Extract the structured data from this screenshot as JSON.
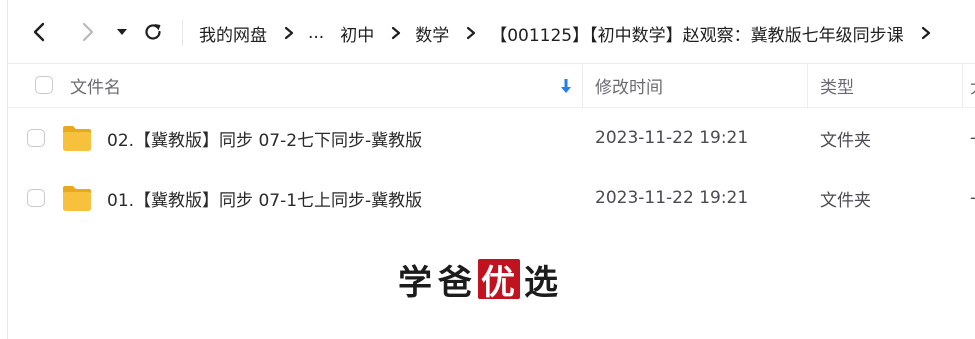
{
  "navigation": {
    "back_icon": "chevron-left-icon",
    "forward_icon": "chevron-right-icon",
    "dropdown_icon": "caret-down-icon",
    "refresh_icon": "refresh-icon"
  },
  "breadcrumb": {
    "items": [
      "我的网盘",
      "...",
      "初中",
      "数学",
      "【001125】【初中数学】赵观察：冀教版七年级同步课"
    ],
    "separator_icon": "chevron-right-icon"
  },
  "table": {
    "headers": {
      "name": "文件名",
      "modified": "修改时间",
      "type": "类型",
      "size": "大"
    },
    "sort_icon": "sort-down-arrow-icon",
    "rows": [
      {
        "name": "02.【冀教版】同步 07-2七下同步-冀教版",
        "modified": "2023-11-22 19:21",
        "type": "文件夹",
        "size": "-",
        "icon": "folder-icon"
      },
      {
        "name": "01.【冀教版】同步 07-1七上同步-冀教版",
        "modified": "2023-11-22 19:21",
        "type": "文件夹",
        "size": "-",
        "icon": "folder-icon"
      }
    ]
  },
  "watermark": {
    "chars": [
      "学",
      "爸",
      "优",
      "选"
    ]
  },
  "colors": {
    "accent": "#1e7ff0",
    "folder": "#f7c13d",
    "seal": "#c1121f",
    "divider": "#ececf0"
  }
}
